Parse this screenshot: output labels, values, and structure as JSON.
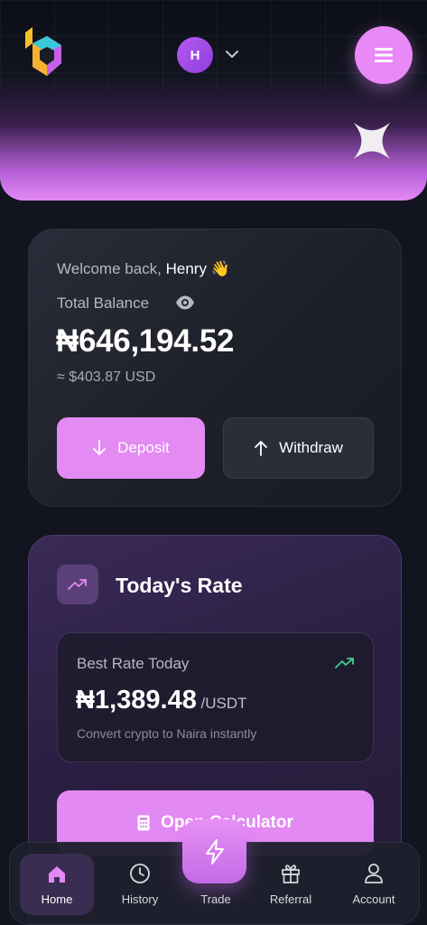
{
  "header": {
    "avatar_initial": "H"
  },
  "balance": {
    "welcome_text": "Welcome back, ",
    "user_name": "Henry",
    "wave_emoji": "👋",
    "total_label": "Total Balance",
    "amount": "₦646,194.52",
    "usd_equivalent": "≈ $403.87 USD",
    "deposit_label": "Deposit",
    "withdraw_label": "Withdraw"
  },
  "rate": {
    "title": "Today's Rate",
    "best_label": "Best Rate Today",
    "best_amount": "₦1,389.48",
    "best_unit": " /USDT",
    "subtitle": "Convert crypto to Naira instantly",
    "calculator_label": "Open Calculator"
  },
  "nav": {
    "home": "Home",
    "history": "History",
    "trade": "Trade",
    "referral": "Referral",
    "account": "Account"
  },
  "colors": {
    "accent": "#e38af3",
    "background": "#121520",
    "trend_green": "#3ecf8e"
  }
}
